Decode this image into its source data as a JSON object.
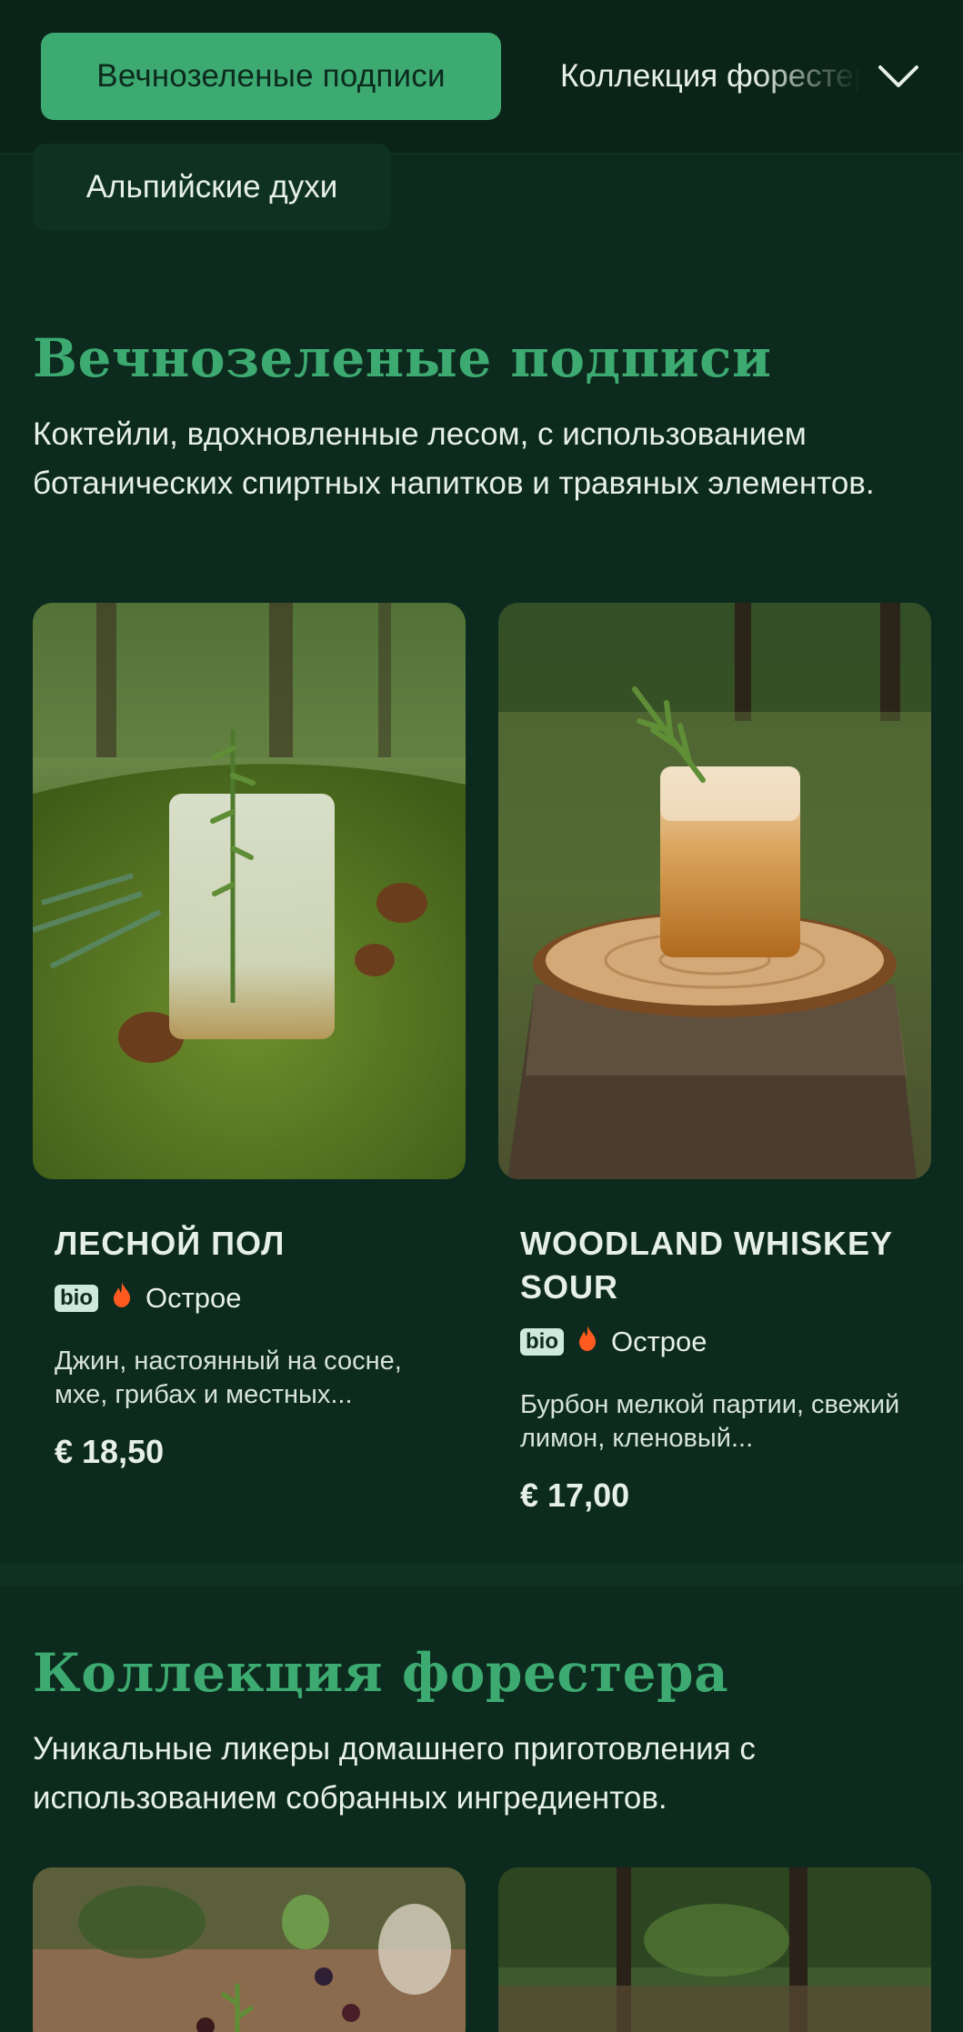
{
  "nav": {
    "active_category": "Вечнозеленые подписи",
    "next_category": "Коллекция форестера",
    "second_row_category": "Альпийские духи"
  },
  "section1": {
    "title": "Вечнозеленые подписи",
    "description": "Коктейли, вдохновленные лесом, с использованием ботанических спиртных напитков и травяных элементов.",
    "items": [
      {
        "name": "ЛЕСНОЙ ПОЛ",
        "badge": "bio",
        "tag": "Острое",
        "description": "Джин, настоянный на сосне, мхе, грибах и местных...",
        "price": "€ 18,50"
      },
      {
        "name": "WOODLAND WHISKEY SOUR",
        "badge": "bio",
        "tag": "Острое",
        "description": "Бурбон мелкой партии, свежий лимон, кленовый...",
        "price": "€ 17,00"
      }
    ]
  },
  "section2": {
    "title": "Коллекция форестера",
    "description": "Уникальные ликеры домашнего приготовления с использованием собранных ингредиентов."
  },
  "colors": {
    "background": "#0c2a1d",
    "accent": "#3daa71",
    "spicy": "#ff5a1f"
  }
}
